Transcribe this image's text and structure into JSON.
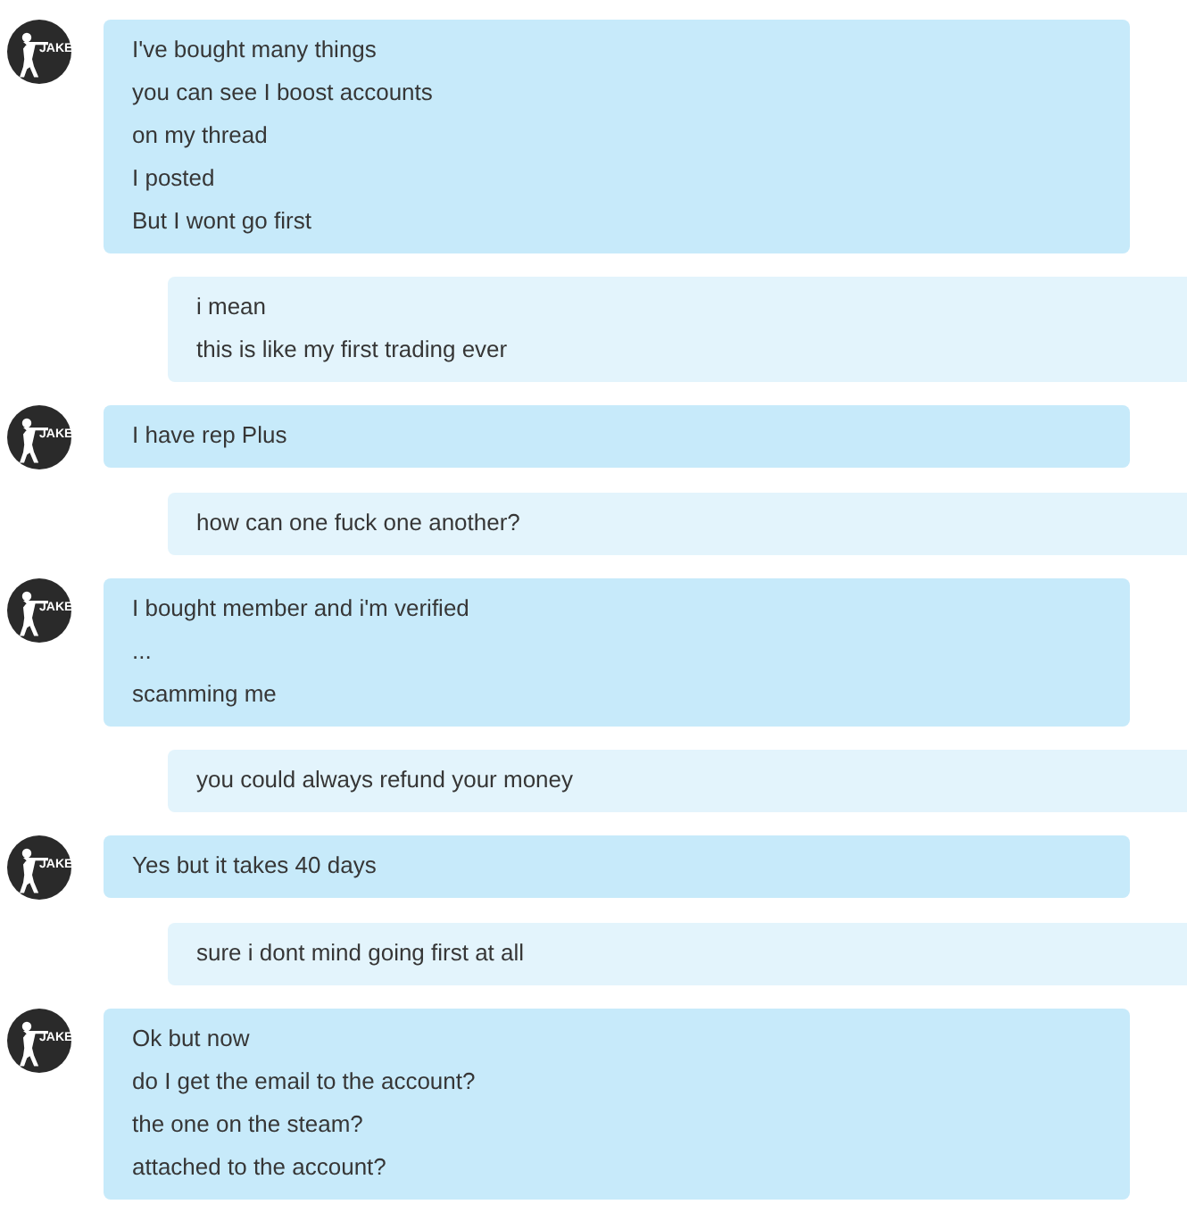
{
  "messages": [
    {
      "kind": "incoming",
      "avatar": {
        "label": "JAKE"
      },
      "lines": [
        "I've bought many things",
        "you can see I boost accounts",
        "on my thread",
        "I posted",
        "But I wont go first"
      ]
    },
    {
      "kind": "outgoing",
      "lines": [
        "i mean",
        "this is like my first trading ever"
      ]
    },
    {
      "kind": "incoming",
      "avatar": {
        "label": "JAKE"
      },
      "lines": [
        "I have rep Plus"
      ]
    },
    {
      "kind": "outgoing",
      "lines": [
        "how can one fuck one another?"
      ]
    },
    {
      "kind": "incoming",
      "avatar": {
        "label": "JAKE"
      },
      "lines": [
        "I bought member and i'm verified",
        "...",
        "scamming me"
      ]
    },
    {
      "kind": "outgoing",
      "lines": [
        "you could always refund your money"
      ]
    },
    {
      "kind": "incoming",
      "avatar": {
        "label": "JAKE"
      },
      "lines": [
        "Yes but it takes 40 days"
      ]
    },
    {
      "kind": "outgoing",
      "lines": [
        "sure i dont mind going first at all"
      ]
    },
    {
      "kind": "incoming",
      "avatar": {
        "label": "JAKE"
      },
      "lines": [
        "Ok but now",
        "do I get the email to the account?",
        "the one on the steam?",
        "attached to the account?"
      ]
    }
  ]
}
